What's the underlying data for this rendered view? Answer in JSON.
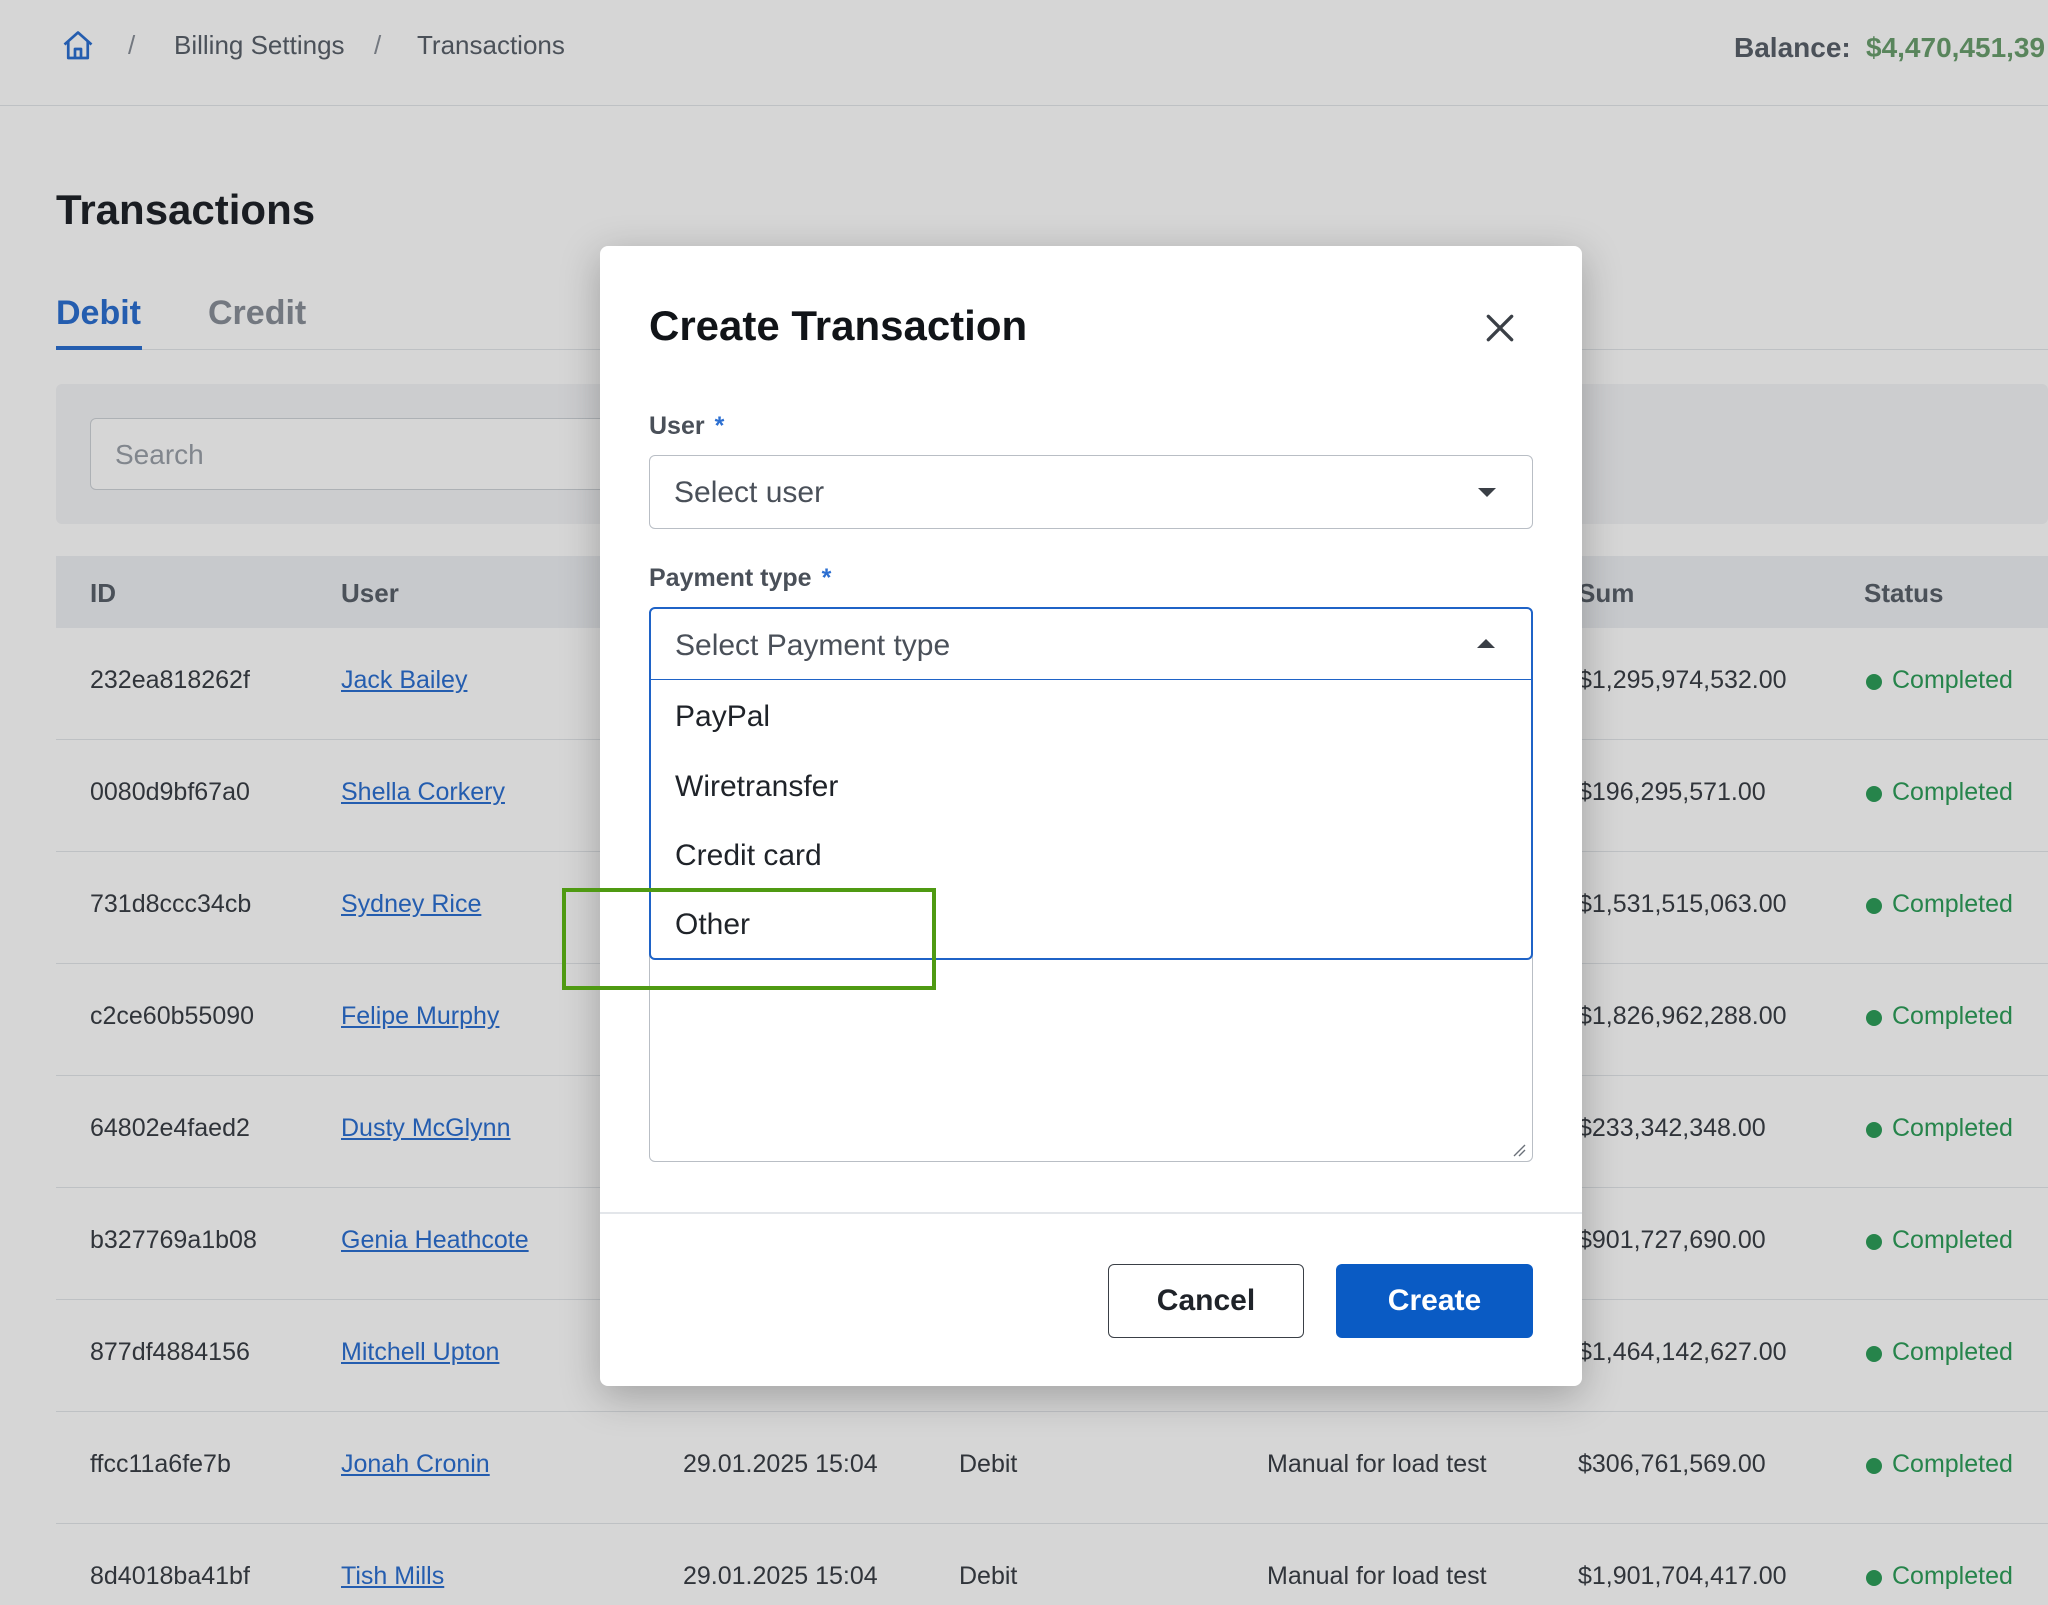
{
  "header": {
    "breadcrumbs": [
      "Billing Settings",
      "Transactions"
    ],
    "separator": "/",
    "balance_label": "Balance:",
    "balance_value": "$4,470,451,39"
  },
  "page": {
    "title": "Transactions",
    "tabs": [
      "Debit",
      "Credit"
    ],
    "search_placeholder": "Search"
  },
  "table": {
    "columns": [
      "ID",
      "User",
      "Sum",
      "Status"
    ],
    "rows": [
      {
        "id": "232ea818262f",
        "user": "Jack Bailey",
        "date": "",
        "type": "",
        "comment": "",
        "sum": "$1,295,974,532.00",
        "status": "Completed"
      },
      {
        "id": "0080d9bf67a0",
        "user": "Shella Corkery",
        "date": "",
        "type": "",
        "comment": "",
        "sum": "$196,295,571.00",
        "status": "Completed"
      },
      {
        "id": "731d8ccc34cb",
        "user": "Sydney Rice",
        "date": "",
        "type": "",
        "comment": "",
        "sum": "$1,531,515,063.00",
        "status": "Completed"
      },
      {
        "id": "c2ce60b55090",
        "user": "Felipe Murphy",
        "date": "",
        "type": "",
        "comment": "",
        "sum": "$1,826,962,288.00",
        "status": "Completed"
      },
      {
        "id": "64802e4faed2",
        "user": "Dusty McGlynn",
        "date": "",
        "type": "",
        "comment": "",
        "sum": "$233,342,348.00",
        "status": "Completed"
      },
      {
        "id": "b327769a1b08",
        "user": "Genia Heathcote",
        "date": "",
        "type": "",
        "comment": "",
        "sum": "$901,727,690.00",
        "status": "Completed"
      },
      {
        "id": "877df4884156",
        "user": "Mitchell Upton",
        "date": "",
        "type": "",
        "comment": "",
        "sum": "$1,464,142,627.00",
        "status": "Completed"
      },
      {
        "id": "ffcc11a6fe7b",
        "user": "Jonah Cronin",
        "date": "29.01.2025 15:04",
        "type": "Debit",
        "comment": "Manual for load test",
        "sum": "$306,761,569.00",
        "status": "Completed"
      },
      {
        "id": "8d4018ba41bf",
        "user": "Tish Mills",
        "date": "29.01.2025 15:04",
        "type": "Debit",
        "comment": "Manual for load test",
        "sum": "$1,901,704,417.00",
        "status": "Completed"
      }
    ]
  },
  "modal": {
    "title": "Create Transaction",
    "user_label": "User",
    "required_mark": "*",
    "user_placeholder": "Select user",
    "payment_label": "Payment type",
    "payment_placeholder": "Select Payment type",
    "payment_options": [
      "PayPal",
      "Wiretransfer",
      "Credit card",
      "Other"
    ],
    "cancel_label": "Cancel",
    "create_label": "Create"
  },
  "colors": {
    "primary": "#0a5bc4",
    "link": "#2c6fd1",
    "success": "#2e9e5a",
    "highlight": "#4f9a12"
  }
}
